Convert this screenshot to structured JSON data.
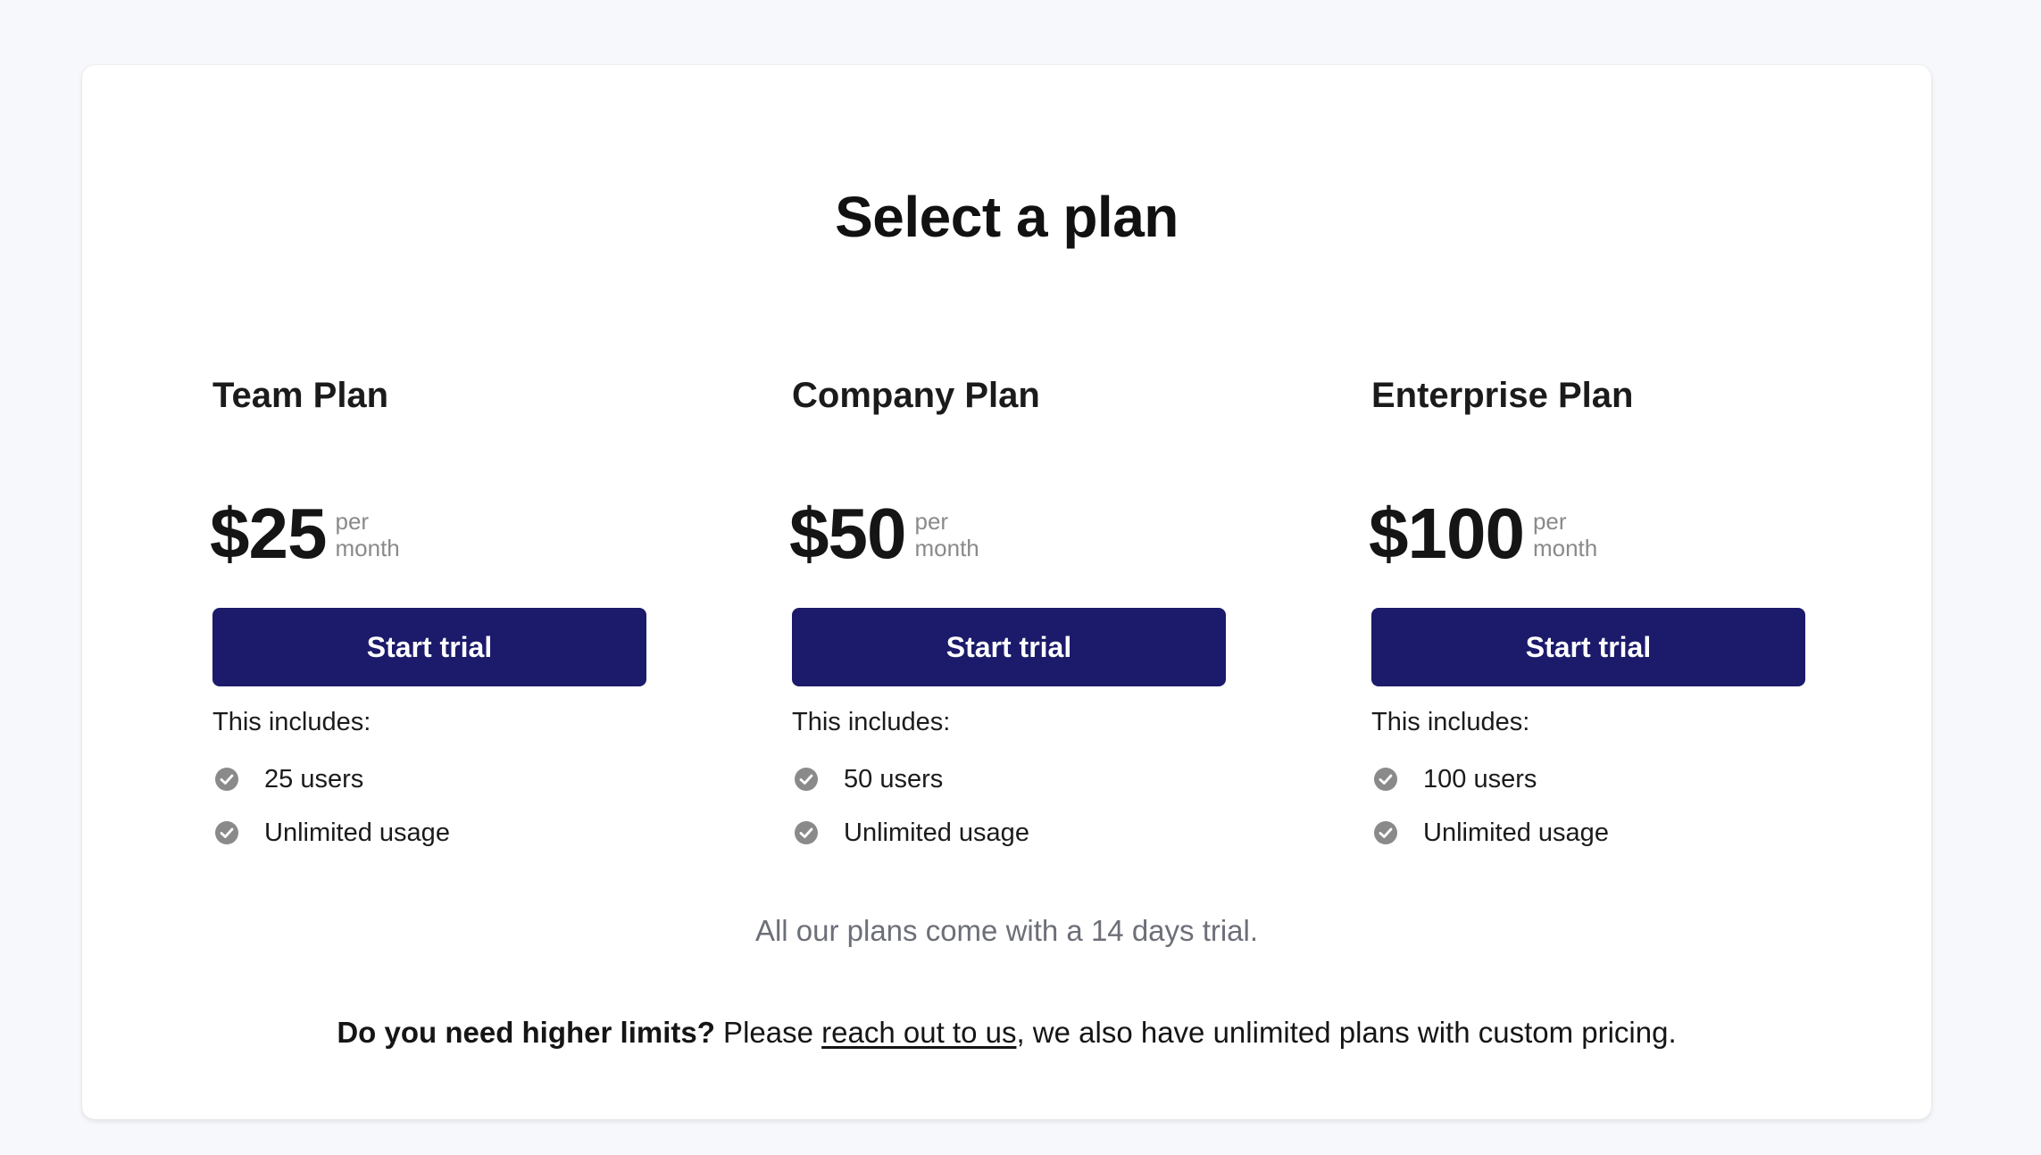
{
  "title": "Select a plan",
  "plans": [
    {
      "name": "Team Plan",
      "price": "$25",
      "period_line1": "per",
      "period_line2": "month",
      "cta_label": "Start trial",
      "includes_label": "This includes:",
      "features": [
        "25 users",
        "Unlimited usage"
      ]
    },
    {
      "name": "Company Plan",
      "price": "$50",
      "period_line1": "per",
      "period_line2": "month",
      "cta_label": "Start trial",
      "includes_label": "This includes:",
      "features": [
        "50 users",
        "Unlimited usage"
      ]
    },
    {
      "name": "Enterprise Plan",
      "price": "$100",
      "period_line1": "per",
      "period_line2": "month",
      "cta_label": "Start trial",
      "includes_label": "This includes:",
      "features": [
        "100 users",
        "Unlimited usage"
      ]
    }
  ],
  "feature_icon": "check-circle-icon",
  "trial_note": "All our plans come with a 14 days trial.",
  "footer": {
    "bold_text": "Do you need higher limits?",
    "pre_link_text": " Please ",
    "link_text": "reach out to us",
    "post_link_text": ", we also have unlimited plans with custom pricing."
  },
  "colors": {
    "button_bg": "#1b1a6b",
    "page_bg": "#f7f8fb",
    "check_icon": "#8a8a8a",
    "muted_text": "#6d6f78"
  }
}
